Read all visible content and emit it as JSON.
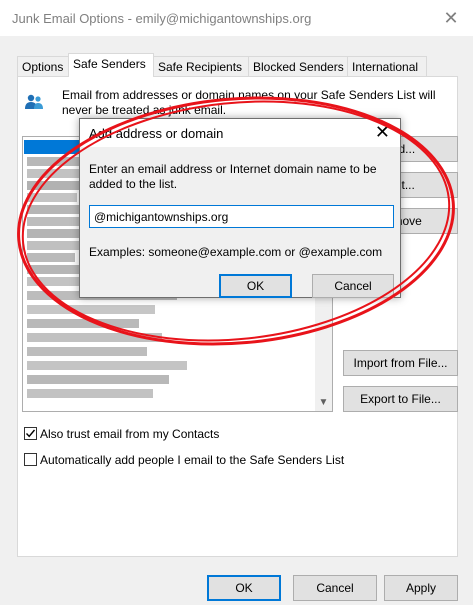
{
  "window": {
    "title": "Junk Email Options - emily@michigantownships.org"
  },
  "tabs": [
    {
      "label": "Options"
    },
    {
      "label": "Safe Senders"
    },
    {
      "label": "Safe Recipients"
    },
    {
      "label": "Blocked Senders"
    },
    {
      "label": "International"
    }
  ],
  "description": "Email from addresses or domain names on your Safe Senders List will never be treated as junk email.",
  "side_buttons": {
    "add": "Add...",
    "edit": "Edit...",
    "remove": "Remove",
    "import": "Import from File...",
    "export": "Export to File..."
  },
  "checkboxes": [
    {
      "label": "Also trust email from my Contacts",
      "checked": true
    },
    {
      "label": "Automatically add people I email to the Safe Senders List",
      "checked": false
    }
  ],
  "footer": {
    "ok": "OK",
    "cancel": "Cancel",
    "apply": "Apply"
  },
  "dialog": {
    "title": "Add address or domain",
    "message": "Enter an email address or Internet domain name to be added to the list.",
    "input_value": "@michigantownships.org",
    "examples": "Examples: someone@example.com or @example.com",
    "ok": "OK",
    "cancel": "Cancel"
  },
  "colors": {
    "accent": "#0078d7",
    "annotation": "#e8131a"
  },
  "icons": {
    "close": "close-icon",
    "people": "people-icon",
    "scroll_down": "chevron-down-icon"
  }
}
